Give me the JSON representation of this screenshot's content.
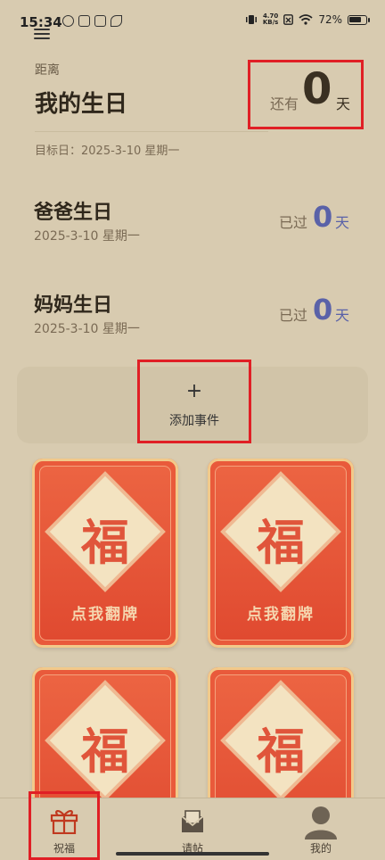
{
  "status_bar": {
    "time": "15:34",
    "net_speed_value": "4.70",
    "net_speed_unit": "KB/s",
    "battery_percent": "72%"
  },
  "main_event": {
    "label": "距离",
    "title": "我的生日",
    "prefix": "还有",
    "count": "0",
    "unit": "天",
    "target_date": "目标日：2025-3-10 星期一"
  },
  "events": [
    {
      "title": "爸爸生日",
      "date": "2025-3-10 星期一",
      "prefix": "已过",
      "count": "0",
      "unit": "天"
    },
    {
      "title": "妈妈生日",
      "date": "2025-3-10 星期一",
      "prefix": "已过",
      "count": "0",
      "unit": "天"
    }
  ],
  "add_event": {
    "icon": "+",
    "label": "添加事件"
  },
  "fu_cards": [
    {
      "char": "福",
      "label": "点我翻牌"
    },
    {
      "char": "福",
      "label": "点我翻牌"
    },
    {
      "char": "福",
      "label": ""
    },
    {
      "char": "福",
      "label": ""
    }
  ],
  "bottom_nav": [
    {
      "label": "祝福",
      "icon": "gift-icon",
      "active": true
    },
    {
      "label": "请帖",
      "icon": "mail-icon",
      "active": false
    },
    {
      "label": "我的",
      "icon": "user-icon",
      "active": false
    }
  ],
  "colors": {
    "background": "#d8cbb0",
    "highlight_box": "#e01f25",
    "passed_count": "#5a62a8",
    "card_red": "#e95a3b"
  }
}
